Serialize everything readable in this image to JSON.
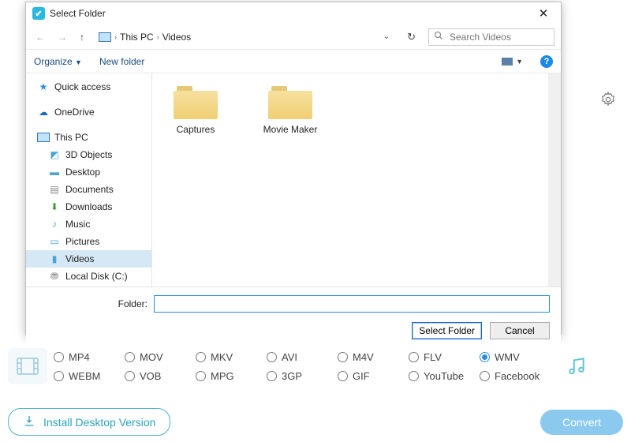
{
  "dialog": {
    "title": "Select Folder",
    "breadcrumb": {
      "root": "This PC",
      "current": "Videos"
    },
    "search_placeholder": "Search Videos",
    "toolbar": {
      "organize": "Organize",
      "newfolder": "New folder"
    },
    "tree": {
      "quick_access": "Quick access",
      "onedrive": "OneDrive",
      "this_pc": "This PC",
      "objects3d": "3D Objects",
      "desktop": "Desktop",
      "documents": "Documents",
      "downloads": "Downloads",
      "music": "Music",
      "pictures": "Pictures",
      "videos": "Videos",
      "localdisk": "Local Disk (C:)"
    },
    "folders": {
      "0": "Captures",
      "1": "Movie Maker"
    },
    "folder_label": "Folder:",
    "folder_value": "",
    "select_btn": "Select Folder",
    "cancel_btn": "Cancel"
  },
  "formats": {
    "mp4": "MP4",
    "mov": "MOV",
    "mkv": "MKV",
    "avi": "AVI",
    "m4v": "M4V",
    "flv": "FLV",
    "wmv": "WMV",
    "webm": "WEBM",
    "vob": "VOB",
    "mpg": "MPG",
    "3gp": "3GP",
    "gif": "GIF",
    "youtube": "YouTube",
    "facebook": "Facebook"
  },
  "footer": {
    "install": "Install Desktop Version",
    "convert": "Convert"
  }
}
